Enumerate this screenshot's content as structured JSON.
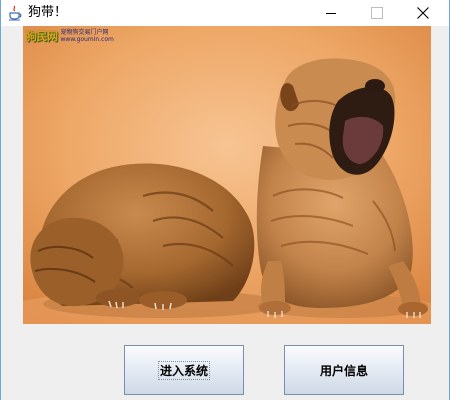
{
  "window": {
    "title": "狗带！",
    "icon": "java-cup-icon",
    "controls": [
      "minimize-icon",
      "maximize-icon",
      "close-icon"
    ]
  },
  "photo": {
    "watermark_main": "狗民网",
    "watermark_line1": "宠物狗交易门户网",
    "watermark_line2": "www.goumin.com"
  },
  "buttons": {
    "enter_label": "进入系统",
    "user_label": "用户信息"
  }
}
